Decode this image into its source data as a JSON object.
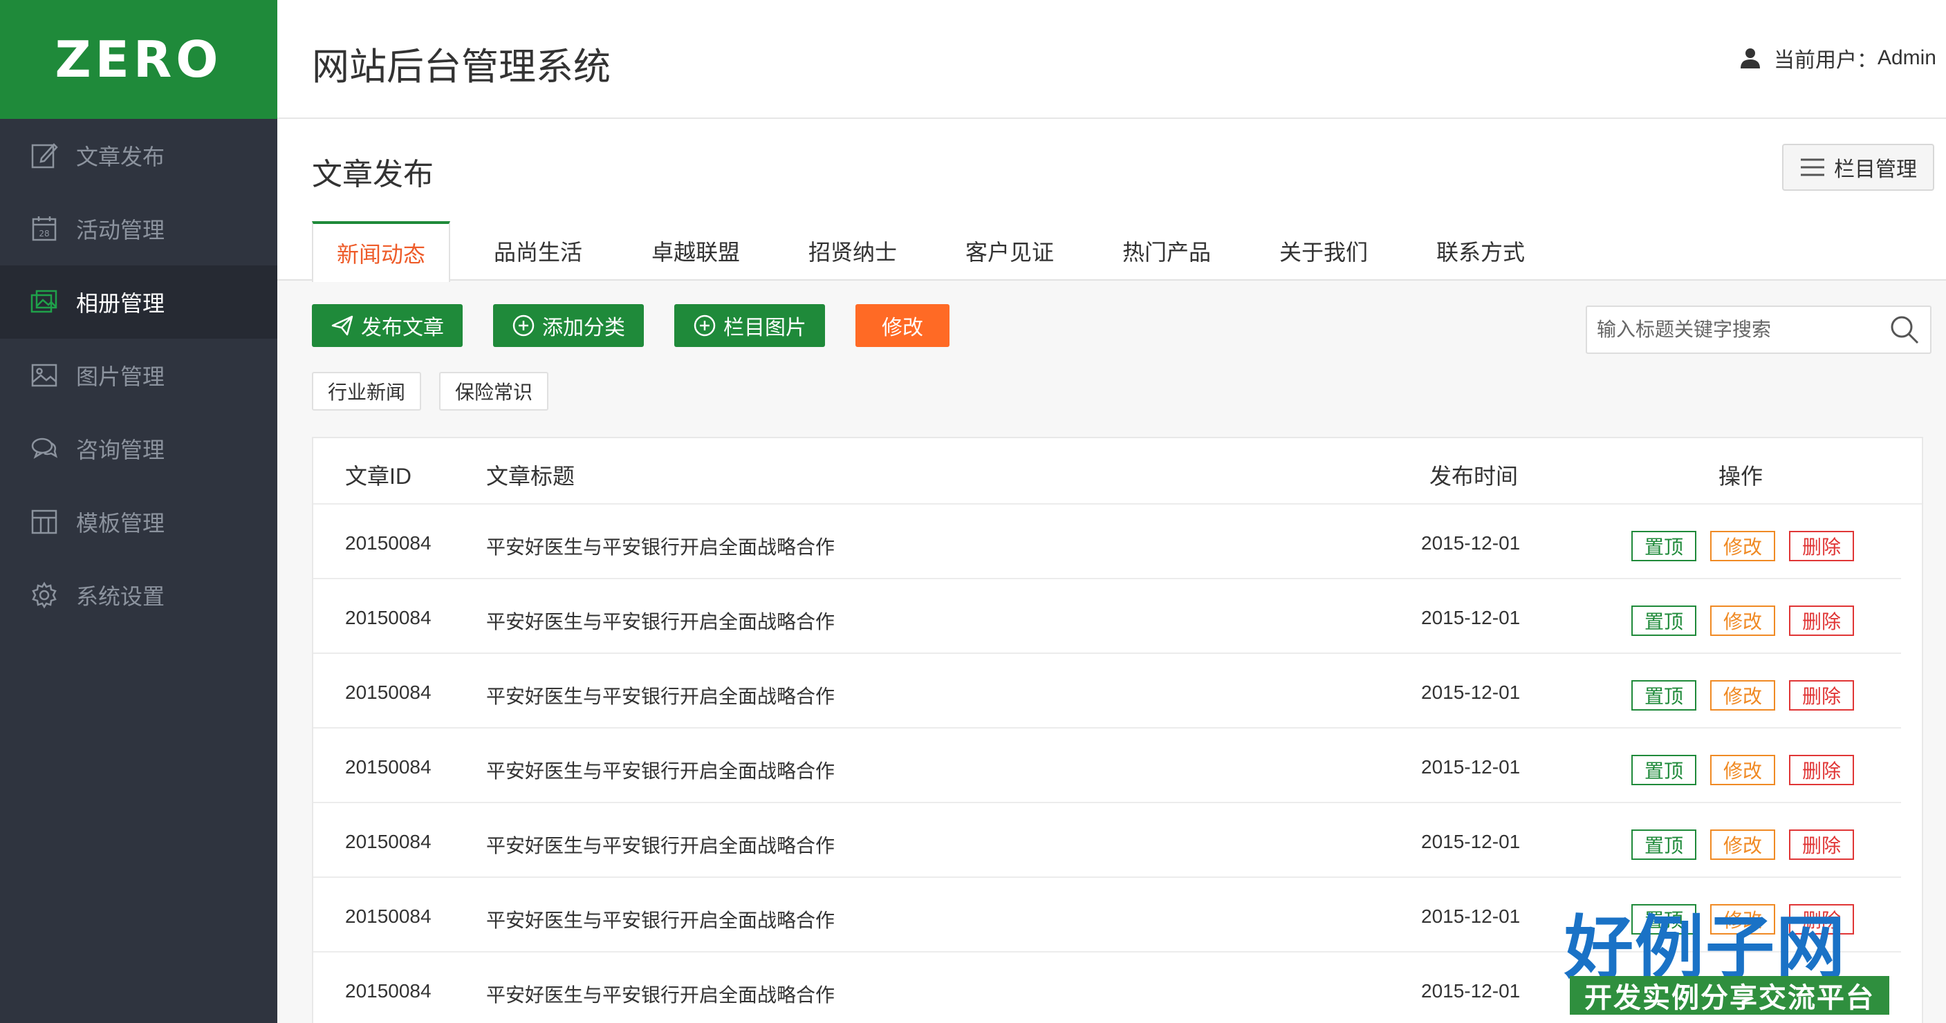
{
  "brand": {
    "logo": "ZERO",
    "accent": "#1f8a3a",
    "orange": "#ff6a25"
  },
  "header": {
    "title": "网站后台管理系统",
    "user_label": "当前用户：",
    "user_name": "Admin"
  },
  "sidebar": {
    "items": [
      {
        "label": "文章发布",
        "icon": "edit-icon",
        "active": false
      },
      {
        "label": "活动管理",
        "icon": "calendar-icon",
        "active": false
      },
      {
        "label": "相册管理",
        "icon": "album-icon",
        "active": true
      },
      {
        "label": "图片管理",
        "icon": "image-icon",
        "active": false
      },
      {
        "label": "咨询管理",
        "icon": "chat-icon",
        "active": false
      },
      {
        "label": "模板管理",
        "icon": "template-icon",
        "active": false
      },
      {
        "label": "系统设置",
        "icon": "gear-icon",
        "active": false
      }
    ]
  },
  "page": {
    "title": "文章发布",
    "column_btn": "栏目管理",
    "tabs": [
      "新闻动态",
      "品尚生活",
      "卓越联盟",
      "招贤纳士",
      "客户见证",
      "热门产品",
      "关于我们",
      "联系方式"
    ],
    "active_tab": 0
  },
  "toolbar": {
    "publish": "发布文章",
    "add_category": "添加分类",
    "column_image": "栏目图片",
    "edit": "修改"
  },
  "search": {
    "placeholder": "输入标题关键字搜索",
    "value": ""
  },
  "subcategories": [
    "行业新闻",
    "保险常识"
  ],
  "table": {
    "headers": {
      "id": "文章ID",
      "title": "文章标题",
      "date": "发布时间",
      "ops": "操作"
    },
    "actions": {
      "top": "置顶",
      "edit": "修改",
      "delete": "删除"
    },
    "rows": [
      {
        "id": "20150084",
        "title": "平安好医生与平安银行开启全面战略合作",
        "date": "2015-12-01"
      },
      {
        "id": "20150084",
        "title": "平安好医生与平安银行开启全面战略合作",
        "date": "2015-12-01"
      },
      {
        "id": "20150084",
        "title": "平安好医生与平安银行开启全面战略合作",
        "date": "2015-12-01"
      },
      {
        "id": "20150084",
        "title": "平安好医生与平安银行开启全面战略合作",
        "date": "2015-12-01"
      },
      {
        "id": "20150084",
        "title": "平安好医生与平安银行开启全面战略合作",
        "date": "2015-12-01"
      },
      {
        "id": "20150084",
        "title": "平安好医生与平安银行开启全面战略合作",
        "date": "2015-12-01"
      },
      {
        "id": "20150084",
        "title": "平安好医生与平安银行开启全面战略合作",
        "date": "2015-12-01"
      }
    ]
  },
  "watermark": {
    "name": "好例子网",
    "slogan": "开发实例分享交流平台"
  }
}
